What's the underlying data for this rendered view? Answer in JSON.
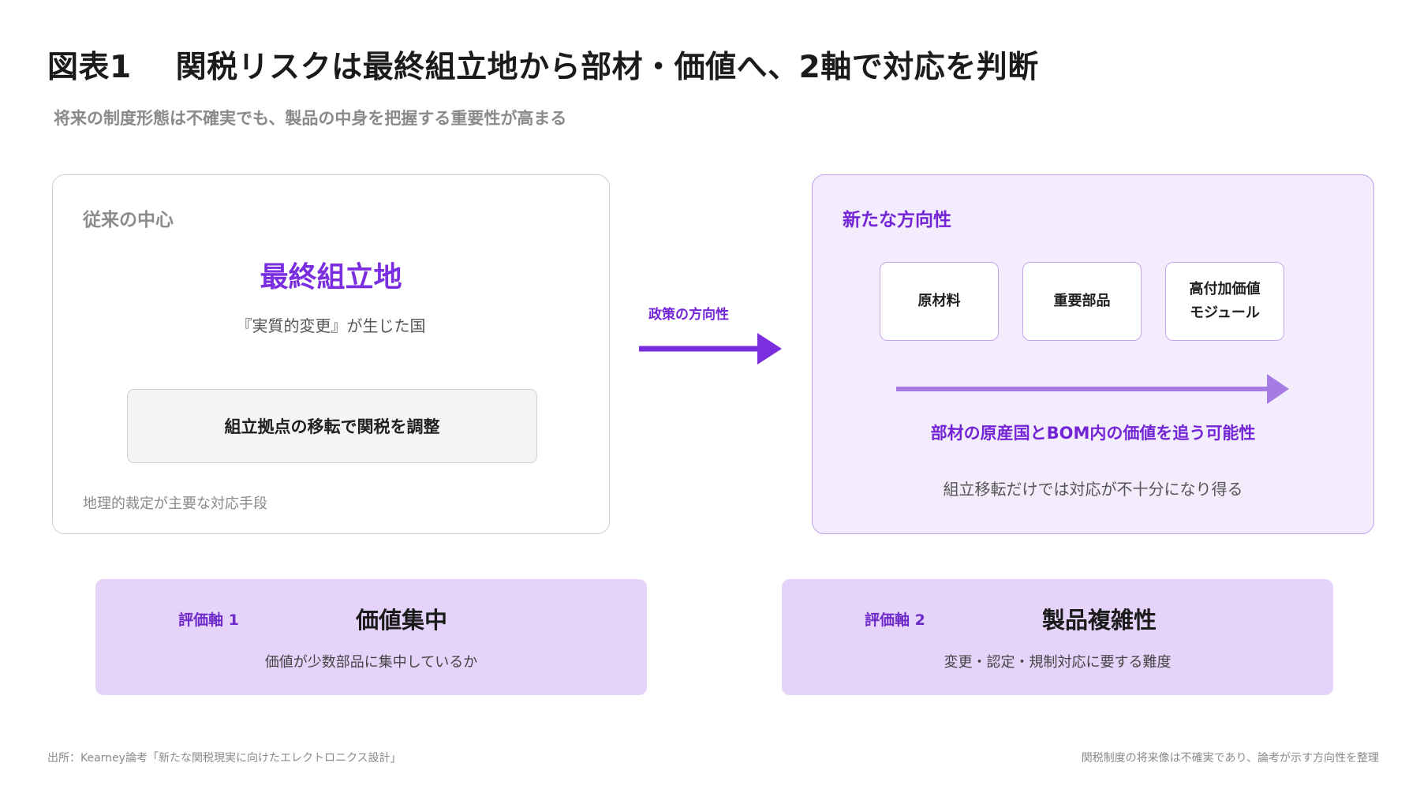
{
  "header": {
    "figure_number": "図表1",
    "title": "関税リスクは最終組立地から部材・価値へ、2軸で対応を判断",
    "subtitle": "将来の制度形態は不確実でも、製品の中身を把握する重要性が高まる"
  },
  "left_panel": {
    "label": "従来の中心",
    "main_word": "最終組立地",
    "main_sub": "『実質的変更』が生じた国",
    "box_text": "組立拠点の移転で関税を調整",
    "note": "地理的裁定が主要な対応手段"
  },
  "arrow": {
    "label": "政策の方向性"
  },
  "right_panel": {
    "label": "新たな方向性",
    "chips": [
      {
        "lines": [
          "原材料"
        ]
      },
      {
        "lines": [
          "重要部品"
        ]
      },
      {
        "lines": [
          "高付加価値",
          "モジュール"
        ]
      }
    ],
    "emphasis": "部材の原産国とBOM内の価値を追う可能性",
    "note": "組立移転だけでは対応が不十分になり得る"
  },
  "axes": [
    {
      "tag": "評価軸 1",
      "title": "価値集中",
      "desc": "価値が少数部品に集中しているか"
    },
    {
      "tag": "評価軸 2",
      "title": "製品複雑性",
      "desc": "変更・認定・規制対応に要する難度"
    }
  ],
  "footer": {
    "source": "出所：Kearney論考「新たな関税現実に向けたエレクトロニクス設計」",
    "note": "関税制度の将来像は不確実であり、論考が示す方向性を整理"
  },
  "colors": {
    "accent": "#7a2ee0",
    "accent_light": "#a57be4",
    "card_fill": "#e6d3f9",
    "panel_fill": "#f3ecfc"
  }
}
